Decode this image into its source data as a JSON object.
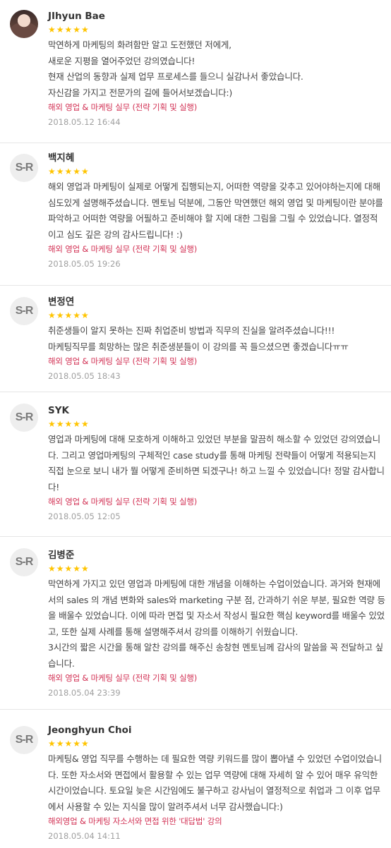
{
  "reviews": [
    {
      "author": "JIhyun Bae",
      "avatar": "profile-photo",
      "rating": "★★★★★",
      "text": [
        "막연하게 마케팅의 화려함만 알고 도전했던 저에게,",
        "새로운 지평을 열어주었던 강의였습니다!",
        "현재 산업의 동향과 실제 업무 프로세스를 들으니 실감나서 좋았습니다.",
        "자신감을 가지고 전문가의 길에 들어서보겠습니다:)"
      ],
      "course": "해외 영업 & 마케팅 실무 (전략 기획 및 실행)",
      "date": "2018.05.12 16:44"
    },
    {
      "author": "백지혜",
      "avatar": "S-R",
      "rating": "★★★★★",
      "text": [
        "해외 영업과 마케팅이 실제로 어떻게 집행되는지, 어떠한 역량을 갖추고 있어야하는지에 대해 심도있게 설명해주셨습니다. 멘토님 덕분에, 그동안 막연했던 해외 영업 및 마케팅이란 분야를 파악하고 어떠한 역량을 어필하고 준비해야 할 지에 대한 그림을 그릴 수 있었습니다. 열정적이고 심도 깊은 강의 감사드립니다! :)"
      ],
      "course": "해외 영업 & 마케팅 실무 (전략 기획 및 실행)",
      "date": "2018.05.05 19:26"
    },
    {
      "author": "변정연",
      "avatar": "S-R",
      "rating": "★★★★★",
      "text": [
        "취준생들이 알지 못하는 진짜 취업준비 방법과 직무의 진실을 알려주셨습니다!!!",
        "마케팅직무를 희망하는 많은 취준생분들이 이 강의를 꼭 들으셨으면 좋겠습니다ㅠㅠ"
      ],
      "course": "해외 영업 & 마케팅 실무 (전략 기획 및 실행)",
      "date": "2018.05.05 18:43"
    },
    {
      "author": "SYK",
      "avatar": "S-R",
      "rating": "★★★★★",
      "text": [
        "영업과 마케팅에 대해 모호하게 이해하고 있었던 부분을 말끔히 해소할 수 있었던 강의였습니다. 그리고 영업마케팅의 구체적인 case study를 통해 마케팅 전략들이 어떻게 적용되는지 직접 눈으로 보니 내가 뭘 어떻게 준비하면 되겠구나! 하고 느낄 수 있었습니다! 정말 감사합니다!"
      ],
      "course": "해외 영업 & 마케팅 실무 (전략 기획 및 실행)",
      "date": "2018.05.05 12:05"
    },
    {
      "author": "김병준",
      "avatar": "S-R",
      "rating": "★★★★★",
      "text": [
        "막연하게 가지고 있던 영업과 마케팅에 대한 개념을 이해하는 수업이었습니다. 과거와 현재에서의 sales 의 개념 변화와 sales와 marketing 구분 점, 간과하기 쉬운 부분, 필요한 역량 등을 배울수 있었습니다. 이에 따라 면접 및 자소서 작성시 필요한 핵심 keyword를 배울수 있었고, 또한 실제 사례를 통해 설명해주셔서 강의를 이해하기 쉬웠습니다.",
        "3시간의 짧은 시간을 통해 알찬 강의를 해주신 송창현 멘토님께 감사의 말씀을 꼭 전달하고 싶습니다."
      ],
      "course": "해외 영업 & 마케팅 실무 (전략 기획 및 실행)",
      "date": "2018.05.04 23:39"
    },
    {
      "author": "Jeonghyun Choi",
      "avatar": "S-R",
      "rating": "★★★★★",
      "text": [
        "마케팅& 영업 직무를 수행하는 데 필요한 역량 키워드를 많이 뽑아낼 수 있었던 수업이었습니다. 또한 자소서와 면접에서 활용할 수 있는 업무 역량에 대해 자세히 알 수 있어 매우 유익한 시간이었습니다. 토요일 늦은 시간임에도 불구하고 강사님이 열정적으로 취업과 그 이후 업무에서 사용할 수 있는 지식을 많이 알려주셔서 너무 감사했습니다:)"
      ],
      "course": "해외영업 & 마케팅 자소서와 면접 위한 '대답법' 강의",
      "date": "2018.05.04 14:11"
    }
  ],
  "colors": {
    "star": "#ffc400",
    "course": "#d23154",
    "date": "#a0a0a0",
    "divider": "#e6e6e6"
  }
}
